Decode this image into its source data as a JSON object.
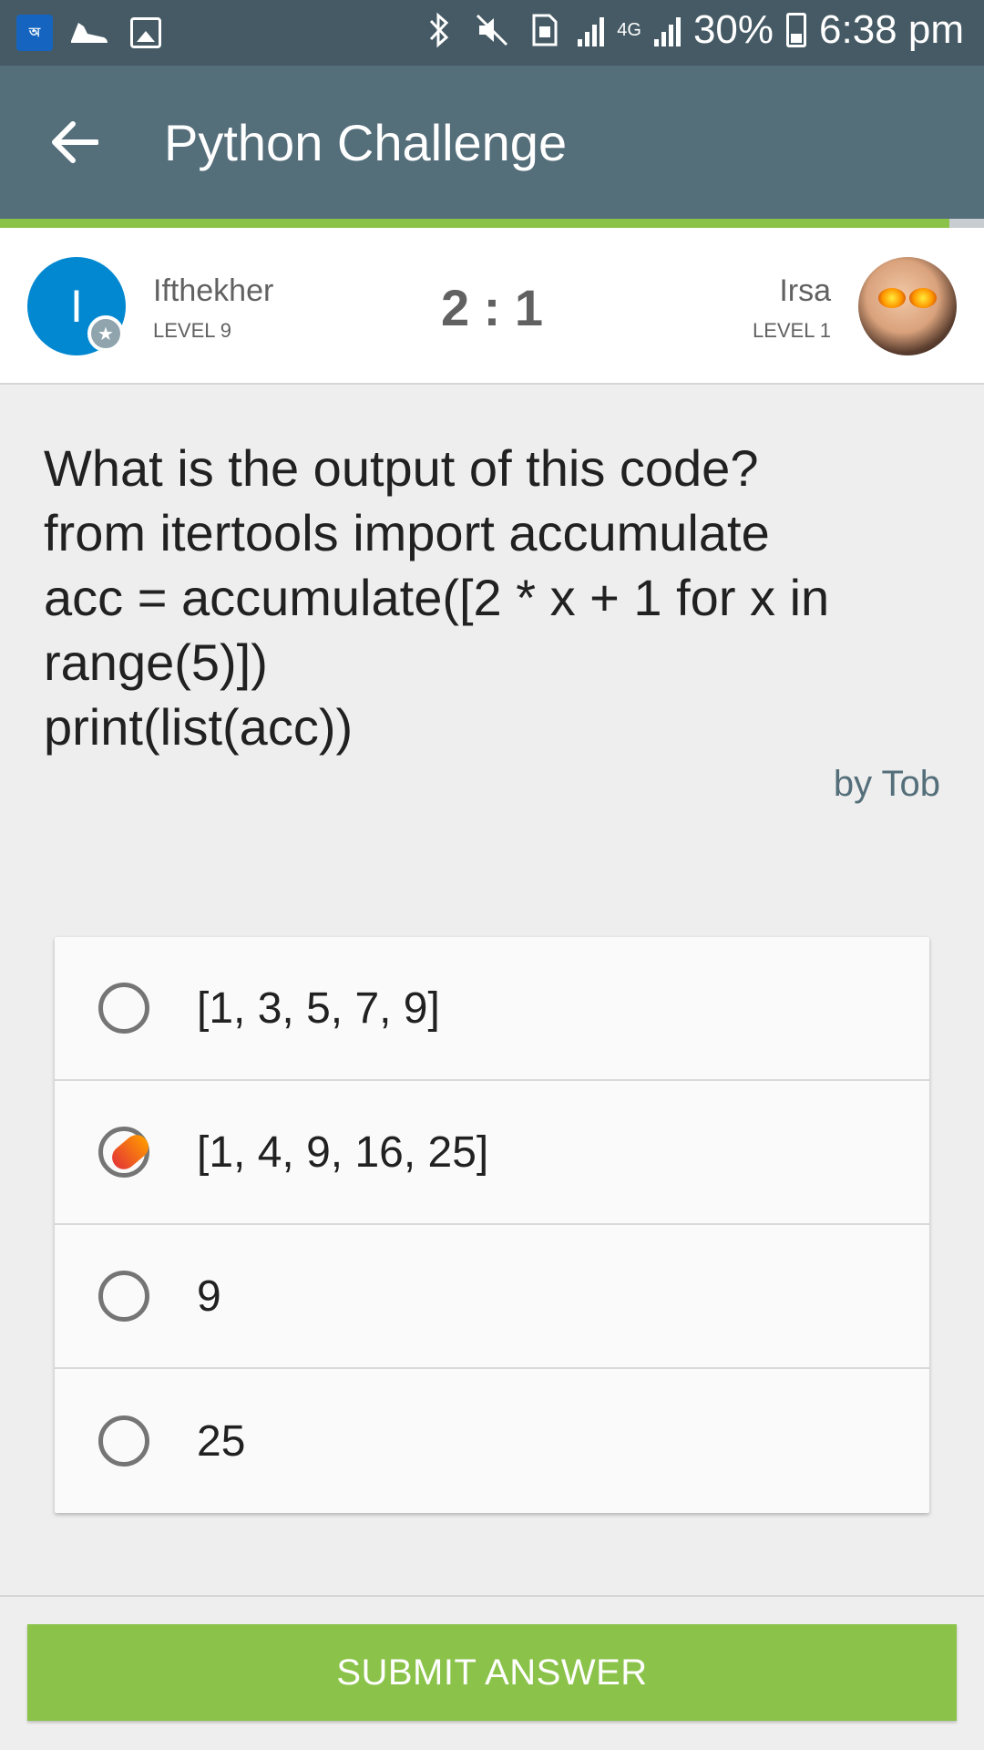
{
  "status_bar": {
    "battery": "30%",
    "time": "6:38 pm",
    "network": "4G",
    "icons": [
      "book-app-icon",
      "shoe-icon",
      "image-icon",
      "bluetooth-icon",
      "mute-icon",
      "sim-icon",
      "signal-icon",
      "signal-icon",
      "battery-icon"
    ]
  },
  "app_bar": {
    "title": "Python Challenge",
    "back_icon": "arrow-left-icon"
  },
  "progress": {
    "fraction": 0.965,
    "color": "#8bc34a"
  },
  "players": {
    "left": {
      "initial": "I",
      "name": "Ifthekher",
      "level": "LEVEL 9",
      "avatar_color": "#0288d1"
    },
    "score": "2 : 1",
    "right": {
      "name": "Irsa",
      "level": "LEVEL 1"
    }
  },
  "question": {
    "text": "What is the output of this code?\nfrom itertools import accumulate\nacc = accumulate([2 * x + 1 for x in\nrange(5)])\nprint(list(acc))",
    "author": "by Tob"
  },
  "options": [
    {
      "label": "[1, 3, 5, 7, 9]",
      "selected": false
    },
    {
      "label": "[1, 4, 9, 16, 25]",
      "selected": true
    },
    {
      "label": "9",
      "selected": false
    },
    {
      "label": "25",
      "selected": false
    }
  ],
  "submit": {
    "label": "SUBMIT ANSWER",
    "color": "#8bc34a"
  }
}
